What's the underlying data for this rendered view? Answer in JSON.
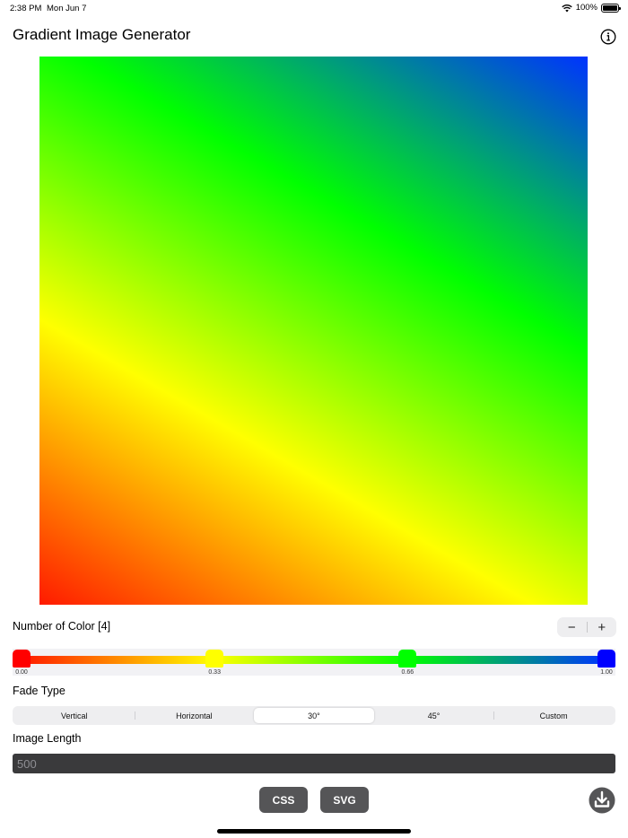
{
  "status_bar": {
    "time": "2:38 PM",
    "date": "Mon Jun 7",
    "battery": "100%",
    "icons": [
      "wifi-icon",
      "battery-icon"
    ]
  },
  "header": {
    "title": "Gradient Image Generator",
    "info_icon": "info-icon"
  },
  "preview": {
    "angle_deg": 30,
    "stops": [
      {
        "color": "#ff1a00",
        "position": 0.0
      },
      {
        "color": "#ffff00",
        "position": 0.33
      },
      {
        "color": "#00ff00",
        "position": 0.66
      },
      {
        "color": "#0033ff",
        "position": 1.0
      }
    ]
  },
  "colors": {
    "label": "Number of Color [4]",
    "stepper_minus": "−",
    "stepper_plus": "+"
  },
  "slider": {
    "handles": [
      {
        "color": "#ff0000",
        "value": "0.00"
      },
      {
        "color": "#ffff00",
        "value": "0.33"
      },
      {
        "color": "#00ff00",
        "value": "0.66"
      },
      {
        "color": "#0000ff",
        "value": "1.00"
      }
    ]
  },
  "fade": {
    "label": "Fade Type",
    "options": [
      "Vertical",
      "Horizontal",
      "30°",
      "45°",
      "Custom"
    ],
    "selected": "30°"
  },
  "image_length": {
    "label": "Image Length",
    "placeholder": "500"
  },
  "actions": {
    "css_label": "CSS",
    "svg_label": "SVG",
    "download_icon": "download-icon"
  }
}
